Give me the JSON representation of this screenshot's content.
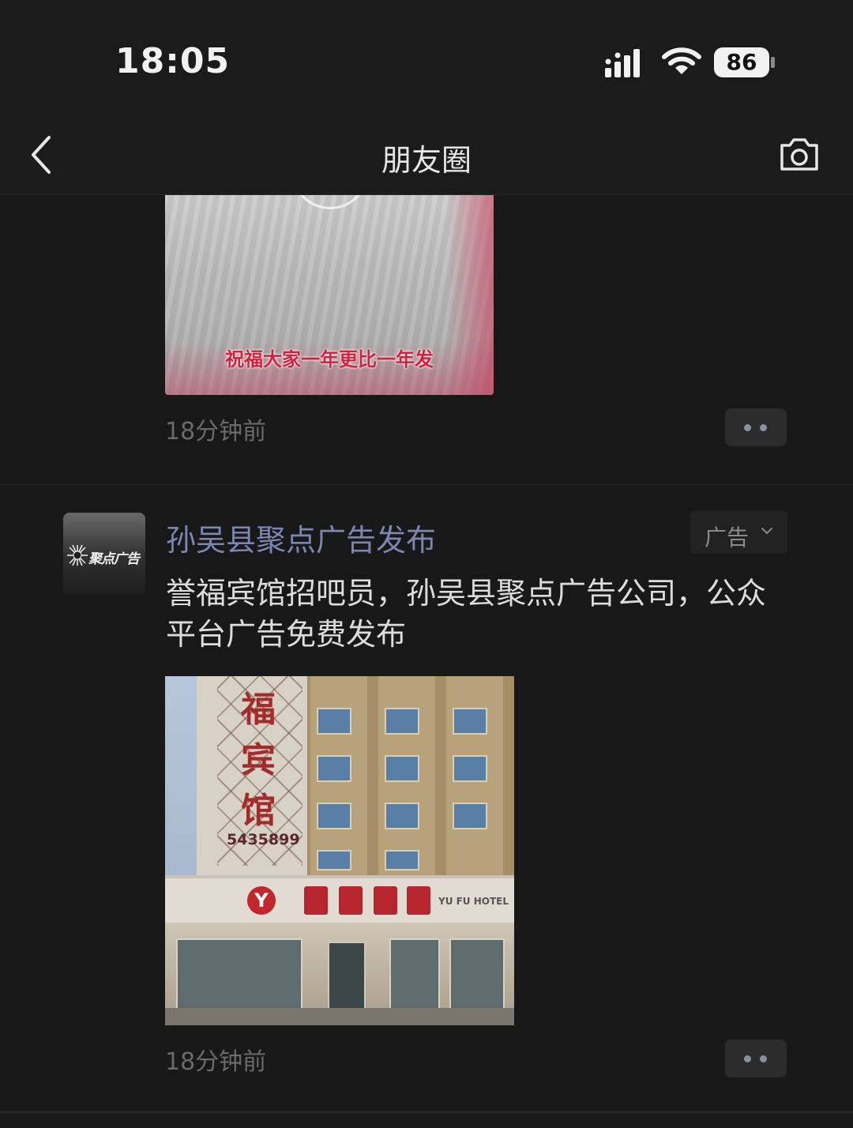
{
  "status_bar": {
    "time": "18:05",
    "battery": "86",
    "icons": [
      "signal-icon",
      "wifi-icon",
      "battery-icon"
    ]
  },
  "nav": {
    "title": "朋友圈",
    "back_icon": "chevron-left-icon",
    "camera_icon": "camera-icon"
  },
  "posts": [
    {
      "image_caption": "祝福大家一年更比一年发",
      "timestamp": "18分钟前"
    },
    {
      "avatar_text": "聚点广告",
      "poster": "孙吴县聚点广告发布",
      "ad_label": "广告",
      "text": "誉福宾馆招吧员，孙吴县聚点广告公司，公众平台广告免费发布",
      "image_sign_vertical": [
        "福",
        "宾",
        "馆"
      ],
      "image_phone": "5435899",
      "image_sign_en": "YU FU HOTEL",
      "timestamp": "18分钟前"
    }
  ],
  "colors": {
    "background": "#181818",
    "poster_name": "#7c86b0",
    "caption_red": "#d81e3c"
  }
}
